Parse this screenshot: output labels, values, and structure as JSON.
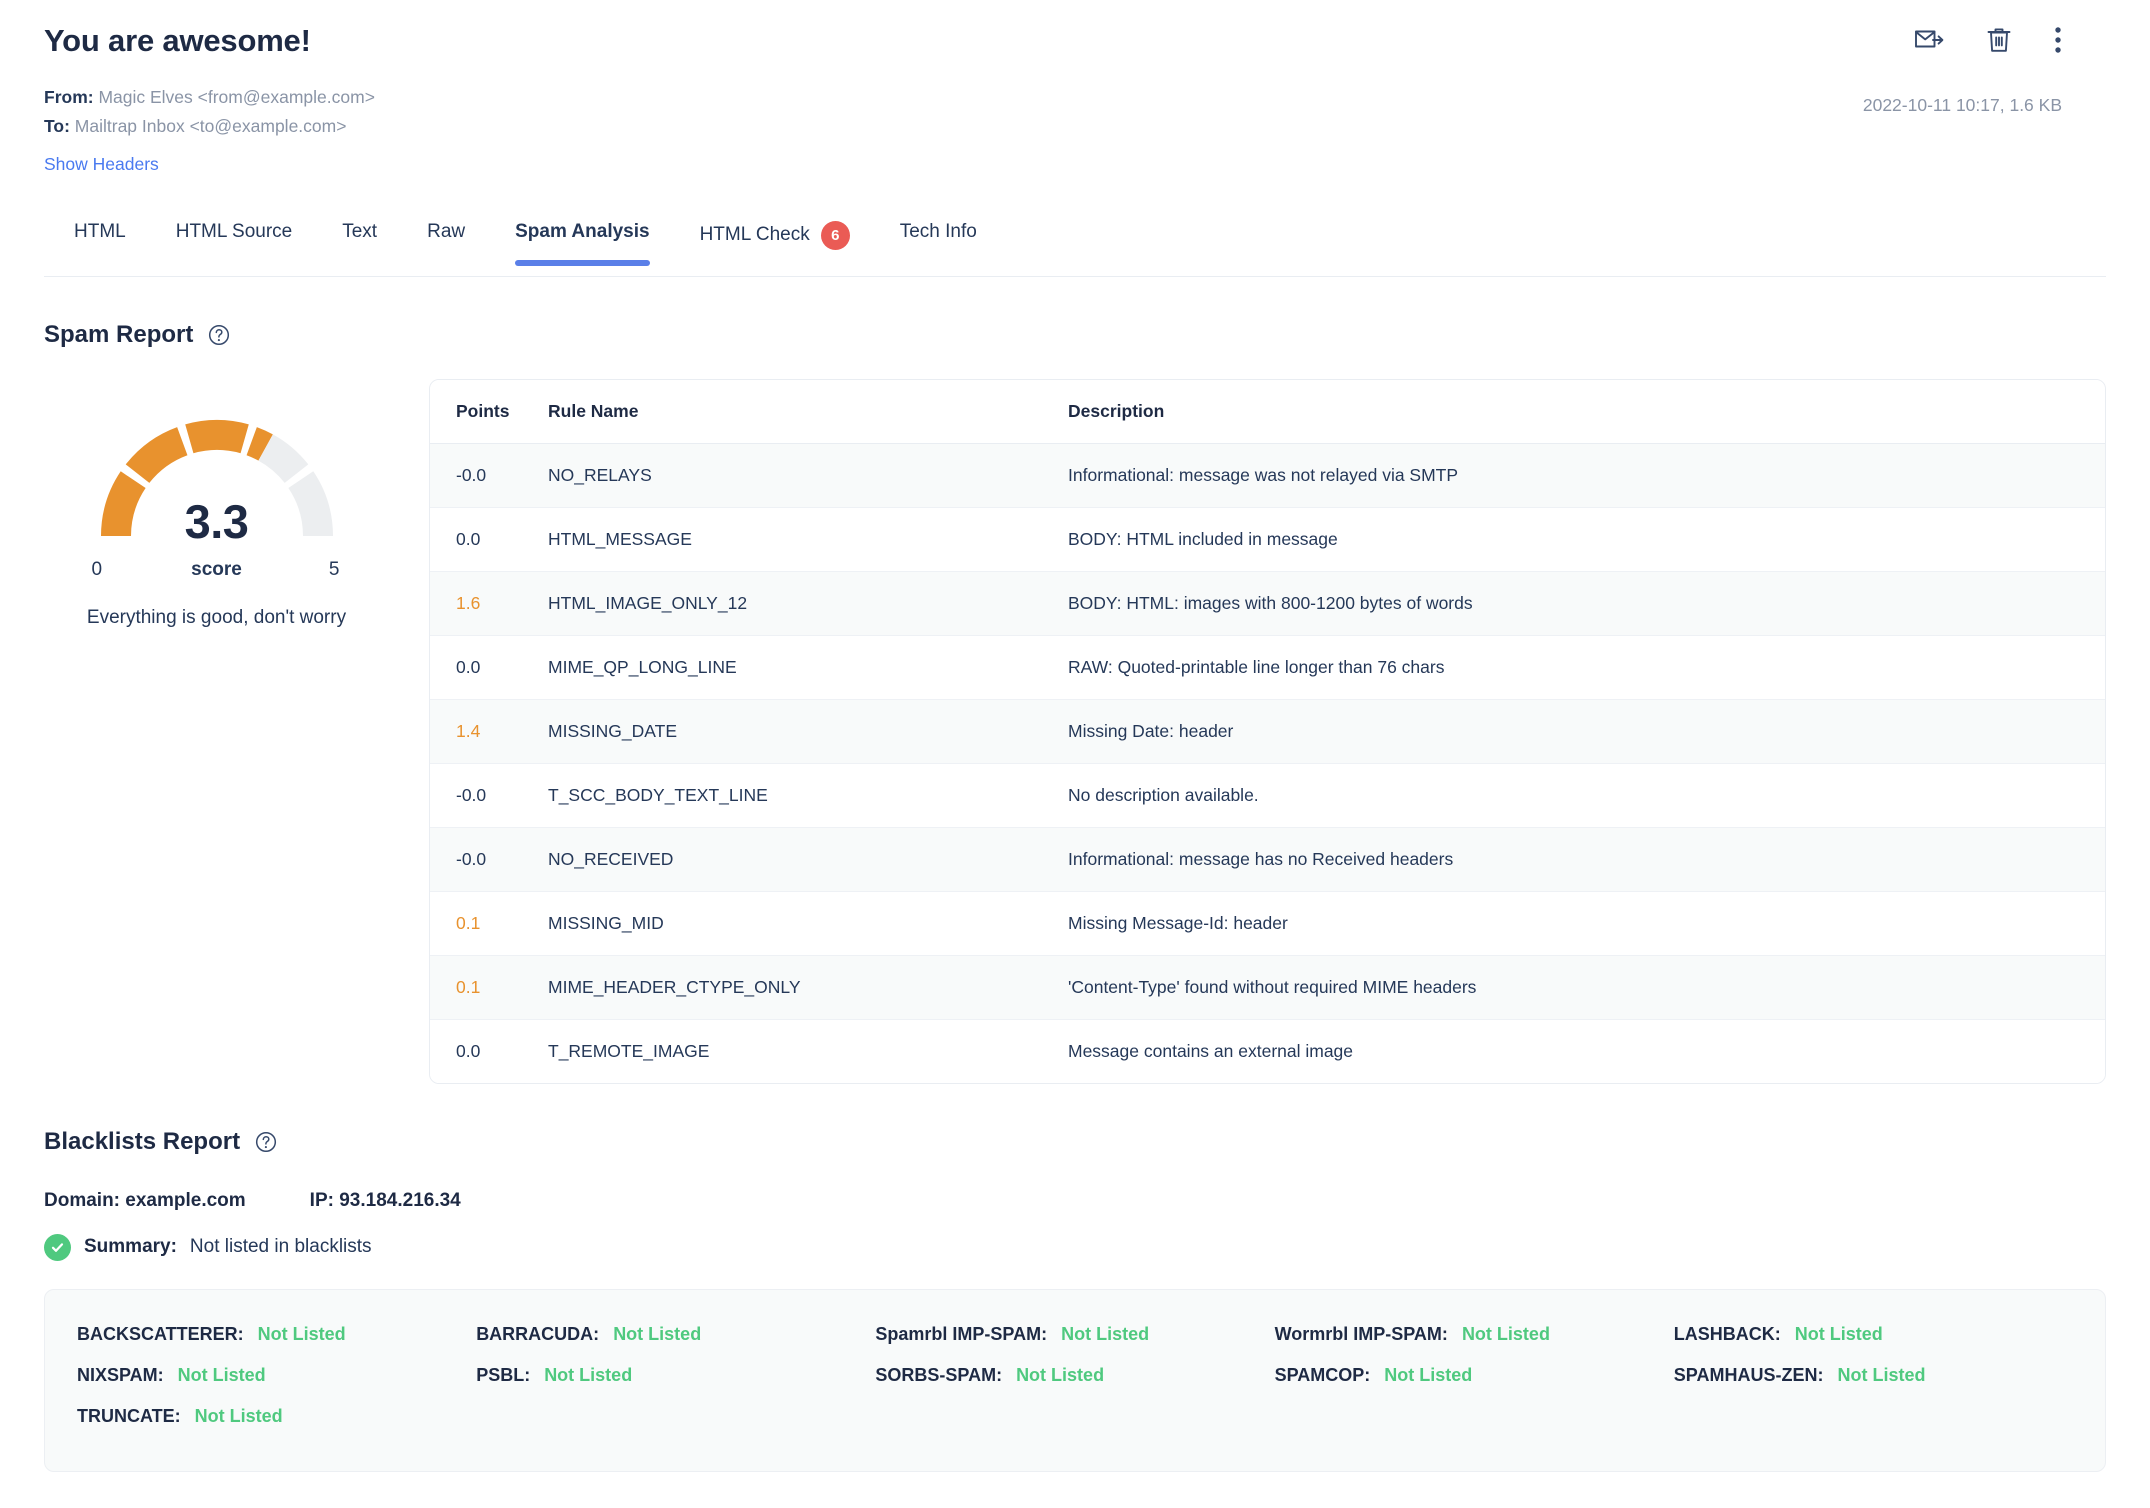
{
  "message": {
    "subject": "You are awesome!",
    "from_label": "From:",
    "from_value": "Magic Elves <from@example.com>",
    "to_label": "To:",
    "to_value": "Mailtrap Inbox <to@example.com>",
    "show_headers": "Show Headers",
    "meta": "2022-10-11 10:17, 1.6 KB"
  },
  "header_actions": [
    {
      "name": "forward-icon",
      "title": "Forward"
    },
    {
      "name": "delete-icon",
      "title": "Delete"
    },
    {
      "name": "more-options-icon",
      "title": "More"
    }
  ],
  "tabs": [
    {
      "label": "HTML",
      "active": false,
      "badge": null
    },
    {
      "label": "HTML Source",
      "active": false,
      "badge": null
    },
    {
      "label": "Text",
      "active": false,
      "badge": null
    },
    {
      "label": "Raw",
      "active": false,
      "badge": null
    },
    {
      "label": "Spam Analysis",
      "active": true,
      "badge": null
    },
    {
      "label": "HTML Check",
      "active": false,
      "badge": "6"
    },
    {
      "label": "Tech Info",
      "active": false,
      "badge": null
    }
  ],
  "spam_report": {
    "title": "Spam Report",
    "gauge": {
      "score": "3.3",
      "min": "0",
      "max": "5",
      "unit_label": "score",
      "caption": "Everything is good, don't worry",
      "score_value": 3.3,
      "max_value": 5,
      "segments": 5,
      "fill_color": "#e8922e",
      "track_color": "#eceef0"
    },
    "table": {
      "columns": [
        "Points",
        "Rule Name",
        "Description"
      ],
      "rows": [
        {
          "points": "-0.0",
          "scored": false,
          "rule": "NO_RELAYS",
          "description": "Informational: message was not relayed via SMTP"
        },
        {
          "points": "0.0",
          "scored": false,
          "rule": "HTML_MESSAGE",
          "description": "BODY: HTML included in message"
        },
        {
          "points": "1.6",
          "scored": true,
          "rule": "HTML_IMAGE_ONLY_12",
          "description": "BODY: HTML: images with 800-1200 bytes of words"
        },
        {
          "points": "0.0",
          "scored": false,
          "rule": "MIME_QP_LONG_LINE",
          "description": "RAW: Quoted-printable line longer than 76 chars"
        },
        {
          "points": "1.4",
          "scored": true,
          "rule": "MISSING_DATE",
          "description": "Missing Date: header"
        },
        {
          "points": "-0.0",
          "scored": false,
          "rule": "T_SCC_BODY_TEXT_LINE",
          "description": "No description available."
        },
        {
          "points": "-0.0",
          "scored": false,
          "rule": "NO_RECEIVED",
          "description": "Informational: message has no Received headers"
        },
        {
          "points": "0.1",
          "scored": true,
          "rule": "MISSING_MID",
          "description": "Missing Message-Id: header"
        },
        {
          "points": "0.1",
          "scored": true,
          "rule": "MIME_HEADER_CTYPE_ONLY",
          "description": "'Content-Type' found without required MIME headers"
        },
        {
          "points": "0.0",
          "scored": false,
          "rule": "T_REMOTE_IMAGE",
          "description": "Message contains an external image"
        }
      ]
    }
  },
  "blacklists_report": {
    "title": "Blacklists Report",
    "domain": "Domain: example.com",
    "ip": "IP: 93.184.216.34",
    "summary_label": "Summary:",
    "summary_value": "Not listed in blacklists",
    "items": [
      {
        "name": "BACKSCATTERER:",
        "status": "Not Listed"
      },
      {
        "name": "BARRACUDA:",
        "status": "Not Listed"
      },
      {
        "name": "Spamrbl IMP-SPAM:",
        "status": "Not Listed"
      },
      {
        "name": "Wormrbl IMP-SPAM:",
        "status": "Not Listed"
      },
      {
        "name": "LASHBACK:",
        "status": "Not Listed"
      },
      {
        "name": "NIXSPAM:",
        "status": "Not Listed"
      },
      {
        "name": "PSBL:",
        "status": "Not Listed"
      },
      {
        "name": "SORBS-SPAM:",
        "status": "Not Listed"
      },
      {
        "name": "SPAMCOP:",
        "status": "Not Listed"
      },
      {
        "name": "SPAMHAUS-ZEN:",
        "status": "Not Listed"
      },
      {
        "name": "TRUNCATE:",
        "status": "Not Listed"
      }
    ]
  },
  "colors": {
    "accent_blue": "#5a7fe8",
    "link_blue": "#4a7af0",
    "warning_orange": "#e8922e",
    "success_green": "#4fc97f",
    "badge_red": "#ea5b55",
    "text_dark": "#1e2a44",
    "text_muted": "#8a94a6"
  }
}
